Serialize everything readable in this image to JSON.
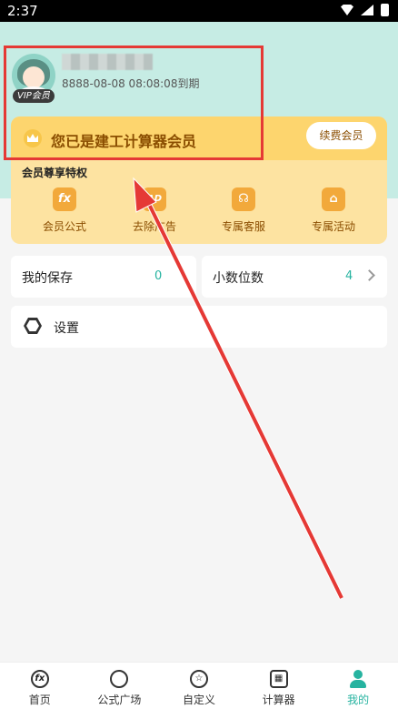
{
  "status_bar": {
    "time": "2:37"
  },
  "profile": {
    "vip_badge": "VIP会员",
    "expire_text": "8888-08-08 08:08:08到期"
  },
  "member_card": {
    "title": "您已是建工计算器会员",
    "renew_label": "续费会员",
    "perks_title": "会员尊享特权",
    "perks": [
      {
        "label": "会员公式",
        "icon": "fx-icon",
        "glyph": "fx"
      },
      {
        "label": "去除广告",
        "icon": "ad-icon",
        "glyph": "AD"
      },
      {
        "label": "专属客服",
        "icon": "headset-icon",
        "glyph": "☊"
      },
      {
        "label": "专属活动",
        "icon": "gift-icon",
        "glyph": "⌂"
      }
    ]
  },
  "rows": {
    "saves_label": "我的保存",
    "saves_value": "0",
    "decimals_label": "小数位数",
    "decimals_value": "4"
  },
  "settings": {
    "label": "设置"
  },
  "tabs": [
    {
      "label": "首页",
      "icon": "fx-icon"
    },
    {
      "label": "公式广场",
      "icon": "planet-icon"
    },
    {
      "label": "自定义",
      "icon": "star-circle-icon"
    },
    {
      "label": "计算器",
      "icon": "calculator-icon"
    },
    {
      "label": "我的",
      "icon": "person-icon",
      "active": true
    }
  ],
  "colors": {
    "accent": "#26b3a0",
    "gold": "#fdd56e",
    "header_bg": "#c6ece4",
    "annotation": "#e53935"
  }
}
